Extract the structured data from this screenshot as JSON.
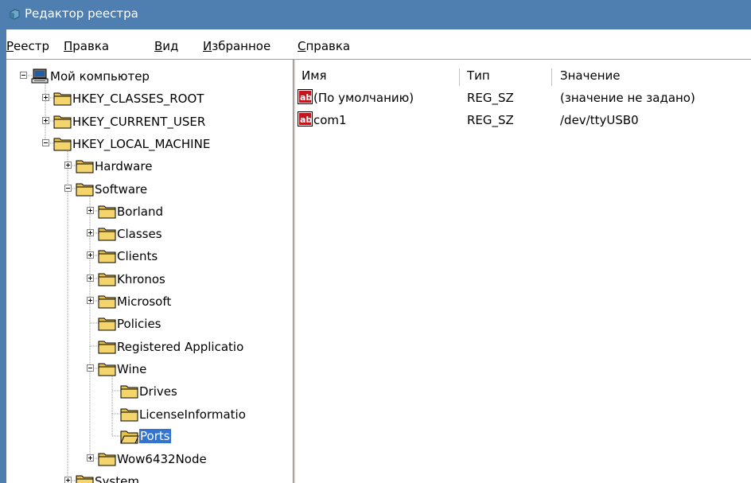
{
  "window": {
    "title": "Редактор реестра",
    "accent": "#4f7fb0"
  },
  "menu": [
    {
      "label": "Реестр",
      "accel_index": 0
    },
    {
      "label": "Правка",
      "accel_index": 0
    },
    {
      "label": "Вид",
      "accel_index": 0
    },
    {
      "label": "Избранное",
      "accel_index": 0
    },
    {
      "label": "Справка",
      "accel_index": 0
    }
  ],
  "tree": [
    {
      "label": "Мой компьютер",
      "depth": 0,
      "expander": "minus",
      "icon": "computer-icon"
    },
    {
      "label": "HKEY_CLASSES_ROOT",
      "depth": 1,
      "expander": "plus",
      "icon": "folder-icon"
    },
    {
      "label": "HKEY_CURRENT_USER",
      "depth": 1,
      "expander": "plus",
      "icon": "folder-icon"
    },
    {
      "label": "HKEY_LOCAL_MACHINE",
      "depth": 1,
      "expander": "minus",
      "icon": "folder-icon"
    },
    {
      "label": "Hardware",
      "depth": 2,
      "expander": "plus",
      "icon": "folder-icon"
    },
    {
      "label": "Software",
      "depth": 2,
      "expander": "minus",
      "icon": "folder-icon"
    },
    {
      "label": "Borland",
      "depth": 3,
      "expander": "plus",
      "icon": "folder-icon"
    },
    {
      "label": "Classes",
      "depth": 3,
      "expander": "plus",
      "icon": "folder-icon"
    },
    {
      "label": "Clients",
      "depth": 3,
      "expander": "plus",
      "icon": "folder-icon"
    },
    {
      "label": "Khronos",
      "depth": 3,
      "expander": "plus",
      "icon": "folder-icon"
    },
    {
      "label": "Microsoft",
      "depth": 3,
      "expander": "plus",
      "icon": "folder-icon"
    },
    {
      "label": "Policies",
      "depth": 3,
      "expander": "none",
      "icon": "folder-icon"
    },
    {
      "label": "Registered Applicatio",
      "depth": 3,
      "expander": "none",
      "icon": "folder-icon"
    },
    {
      "label": "Wine",
      "depth": 3,
      "expander": "minus",
      "icon": "folder-icon"
    },
    {
      "label": "Drives",
      "depth": 4,
      "expander": "none",
      "icon": "folder-icon"
    },
    {
      "label": "LicenseInformatio",
      "depth": 4,
      "expander": "none",
      "icon": "folder-icon"
    },
    {
      "label": "Ports",
      "depth": 4,
      "expander": "none",
      "icon": "open-folder-icon",
      "selected": true
    },
    {
      "label": "Wow6432Node",
      "depth": 3,
      "expander": "plus",
      "icon": "folder-icon"
    },
    {
      "label": "System",
      "depth": 2,
      "expander": "plus",
      "icon": "folder-icon"
    }
  ],
  "list": {
    "columns": [
      "Имя",
      "Тип",
      "Значение"
    ],
    "rows": [
      {
        "name": "(По умолчанию)",
        "type": "REG_SZ",
        "value": "(значение не задано)",
        "icon": "string-value-icon"
      },
      {
        "name": "com1",
        "type": "REG_SZ",
        "value": "/dev/ttyUSB0",
        "icon": "string-value-icon"
      }
    ]
  },
  "colors": {
    "selection": "#3374d0",
    "folder": "#f3d56b"
  }
}
